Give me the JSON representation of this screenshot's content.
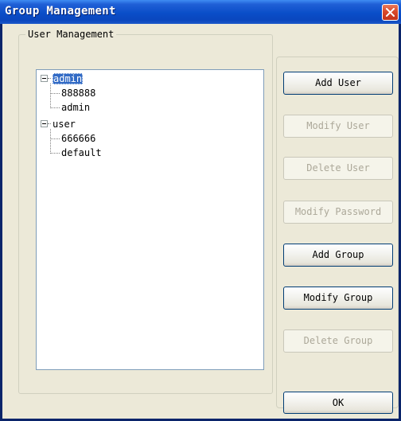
{
  "window": {
    "title": "Group Management",
    "close_icon": "close-icon"
  },
  "groupbox": {
    "label": "User Management"
  },
  "tree": {
    "nodes": [
      {
        "label": "admin",
        "level": 0,
        "selected": true,
        "expanded": true
      },
      {
        "label": "888888",
        "level": 1
      },
      {
        "label": "admin",
        "level": 1
      },
      {
        "label": "user",
        "level": 0,
        "expanded": true
      },
      {
        "label": "666666",
        "level": 1
      },
      {
        "label": "default",
        "level": 1
      }
    ]
  },
  "buttons": {
    "add_user": {
      "label": "Add User",
      "enabled": true
    },
    "modify_user": {
      "label": "Modify User",
      "enabled": false
    },
    "delete_user": {
      "label": "Delete User",
      "enabled": false
    },
    "modify_password": {
      "label": "Modify Password",
      "enabled": false
    },
    "add_group": {
      "label": "Add Group",
      "enabled": true
    },
    "modify_group": {
      "label": "Modify Group",
      "enabled": true
    },
    "delete_group": {
      "label": "Delete Group",
      "enabled": false
    },
    "ok": {
      "label": "OK",
      "enabled": true
    }
  },
  "colors": {
    "titlebar": "#0a4ec8",
    "selection": "#316ac5",
    "dialog_bg": "#ece9d8",
    "disabled_text": "#aca899"
  }
}
